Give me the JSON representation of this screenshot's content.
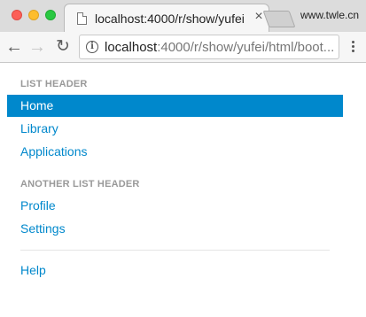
{
  "browser": {
    "tab_title": "localhost:4000/r/show/yufei/",
    "tab_close": "×",
    "profile_text": "www.twle.cn",
    "url_host": "localhost",
    "url_rest": ":4000/r/show/yufei/html/boot...",
    "back_glyph": "←",
    "forward_glyph": "→",
    "reload_glyph": "↻",
    "info_glyph": "i"
  },
  "nav": {
    "header1": "LIST HEADER",
    "items1": [
      "Home",
      "Library",
      "Applications"
    ],
    "active_item": "Home",
    "header2": "ANOTHER LIST HEADER",
    "items2": [
      "Profile",
      "Settings"
    ],
    "items3": [
      "Help"
    ]
  },
  "colors": {
    "link": "#0088cc",
    "active_bg": "#0088cc",
    "header": "#999999"
  }
}
